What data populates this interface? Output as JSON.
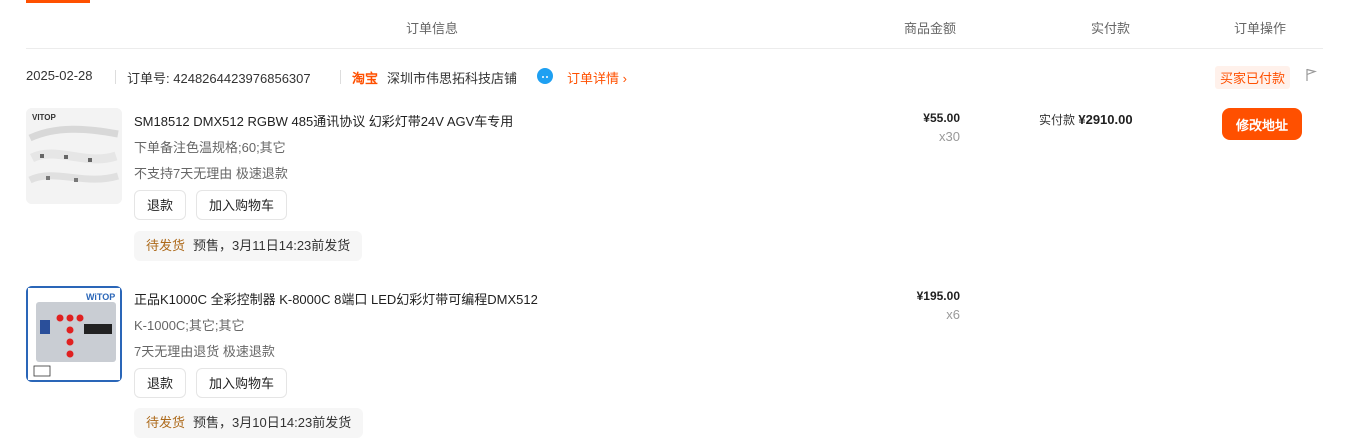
{
  "header": {
    "col_order_info": "订单信息",
    "col_amount": "商品金额",
    "col_paid": "实付款",
    "col_action": "订单操作"
  },
  "order": {
    "date": "2025-02-28",
    "order_no_label": "订单号:",
    "order_no": "4248264423976856307",
    "platform": "淘宝",
    "shop": "深圳市伟思拓科技店铺",
    "detail_link": "订单详情",
    "status": "买家已付款",
    "paid_label": "实付款",
    "paid_amount": "¥2910.00",
    "action": "修改地址"
  },
  "items": [
    {
      "title": "SM18512 DMX512 RGBW 485通讯协议 幻彩灯带24V AGV车专用",
      "spec": "下单备注色温规格;60;其它",
      "service": "不支持7天无理由 极速退款",
      "btn_refund": "退款",
      "btn_cart": "加入购物车",
      "ship_status": "待发货",
      "ship_note": "预售，3月11日14:23前发货",
      "price": "¥55.00",
      "qty": "x30",
      "thumb_brand": "VITOP"
    },
    {
      "title": "正品K1000C 全彩控制器 K-8000C 8端口 LED幻彩灯带可编程DMX512",
      "spec": "K-1000C;其它;其它",
      "service": "7天无理由退货 极速退款",
      "btn_refund": "退款",
      "btn_cart": "加入购物车",
      "ship_status": "待发货",
      "ship_note": "预售，3月10日14:23前发货",
      "price": "¥195.00",
      "qty": "x6",
      "thumb_brand": "WiTOP"
    }
  ],
  "icons": {
    "wangwang": "wangwang-chat-icon",
    "chevron": "chevron-right-icon",
    "flag": "flag-icon"
  },
  "colors": {
    "accent": "#ff5000",
    "status_bg": "#fff1eb",
    "ship_status": "#ad6a1b"
  }
}
